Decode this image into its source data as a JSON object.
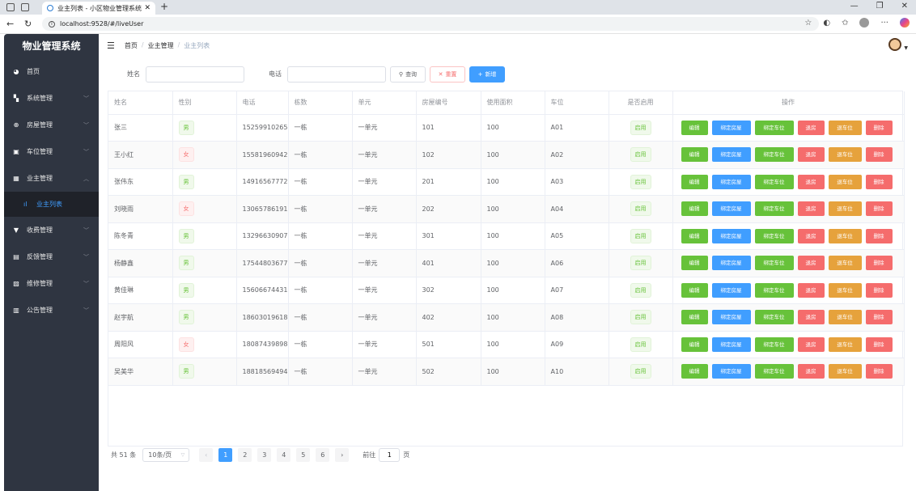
{
  "browser": {
    "tab_title": "业主列表 - 小区物业管理系统",
    "url": "localhost:9528/#/liveUser"
  },
  "sidebar": {
    "title": "物业管理系统",
    "items": [
      {
        "label": "首页",
        "icon": "dashboard-icon"
      },
      {
        "label": "系统管理",
        "icon": "grid-icon"
      },
      {
        "label": "房屋管理",
        "icon": "circle-plus-icon"
      },
      {
        "label": "车位管理",
        "icon": "parking-icon"
      },
      {
        "label": "业主管理",
        "icon": "table-icon"
      },
      {
        "label": "收费管理",
        "icon": "coin-icon"
      },
      {
        "label": "反馈管理",
        "icon": "calendar-icon"
      },
      {
        "label": "维修管理",
        "icon": "picture-icon"
      },
      {
        "label": "公告管理",
        "icon": "copy-icon"
      }
    ],
    "active_sub": {
      "label": "业主列表",
      "icon": "bar-chart-icon"
    }
  },
  "header": {
    "breadcrumb": [
      "首页",
      "业主管理",
      "业主列表"
    ]
  },
  "search": {
    "name_label": "姓名",
    "name_value": "",
    "phone_label": "电话",
    "phone_value": "",
    "query_label": "查询",
    "reset_label": "重置",
    "add_label": "新增"
  },
  "table": {
    "columns": [
      "姓名",
      "性别",
      "电话",
      "栋数",
      "单元",
      "房屋编号",
      "使用面积",
      "车位",
      "是否启用",
      "操作"
    ],
    "actions": [
      "编辑",
      "绑定房屋",
      "绑定车位",
      "退房",
      "退车位",
      "删除"
    ],
    "rows": [
      {
        "name": "张三",
        "sex": "男",
        "phone": "15259910265",
        "building": "一栋",
        "unit": "一单元",
        "house": "101",
        "area": "100",
        "parking": "A01",
        "status": "启用"
      },
      {
        "name": "王小红",
        "sex": "女",
        "phone": "15581960942",
        "building": "一栋",
        "unit": "一单元",
        "house": "102",
        "area": "100",
        "parking": "A02",
        "status": "启用"
      },
      {
        "name": "张伟东",
        "sex": "男",
        "phone": "14916567772",
        "building": "一栋",
        "unit": "一单元",
        "house": "201",
        "area": "100",
        "parking": "A03",
        "status": "启用"
      },
      {
        "name": "刘晓雨",
        "sex": "女",
        "phone": "13065786191",
        "building": "一栋",
        "unit": "一单元",
        "house": "202",
        "area": "100",
        "parking": "A04",
        "status": "启用"
      },
      {
        "name": "陈冬青",
        "sex": "男",
        "phone": "13296630907",
        "building": "一栋",
        "unit": "一单元",
        "house": "301",
        "area": "100",
        "parking": "A05",
        "status": "启用"
      },
      {
        "name": "杨静鑫",
        "sex": "男",
        "phone": "17544803677",
        "building": "一栋",
        "unit": "一单元",
        "house": "401",
        "area": "100",
        "parking": "A06",
        "status": "启用"
      },
      {
        "name": "黄佳琳",
        "sex": "男",
        "phone": "15606674431",
        "building": "一栋",
        "unit": "一单元",
        "house": "302",
        "area": "100",
        "parking": "A07",
        "status": "启用"
      },
      {
        "name": "赵宇航",
        "sex": "男",
        "phone": "18603019618",
        "building": "一栋",
        "unit": "一单元",
        "house": "402",
        "area": "100",
        "parking": "A08",
        "status": "启用"
      },
      {
        "name": "周阳风",
        "sex": "女",
        "phone": "18087439898",
        "building": "一栋",
        "unit": "一单元",
        "house": "501",
        "area": "100",
        "parking": "A09",
        "status": "启用"
      },
      {
        "name": "吴美华",
        "sex": "男",
        "phone": "18818569494",
        "building": "一栋",
        "unit": "一单元",
        "house": "502",
        "area": "100",
        "parking": "A10",
        "status": "启用"
      }
    ]
  },
  "pagination": {
    "total": "共 51 条",
    "page_size": "10条/页",
    "pages": [
      "1",
      "2",
      "3",
      "4",
      "5",
      "6"
    ],
    "current": "1",
    "goto_prefix": "前往",
    "goto_value": "1",
    "goto_suffix": "页"
  },
  "colors": {
    "sidebar_bg": "#2f3541",
    "primary": "#409eff",
    "success": "#67c23a",
    "danger": "#f56c6c",
    "warning": "#e6a23c"
  }
}
